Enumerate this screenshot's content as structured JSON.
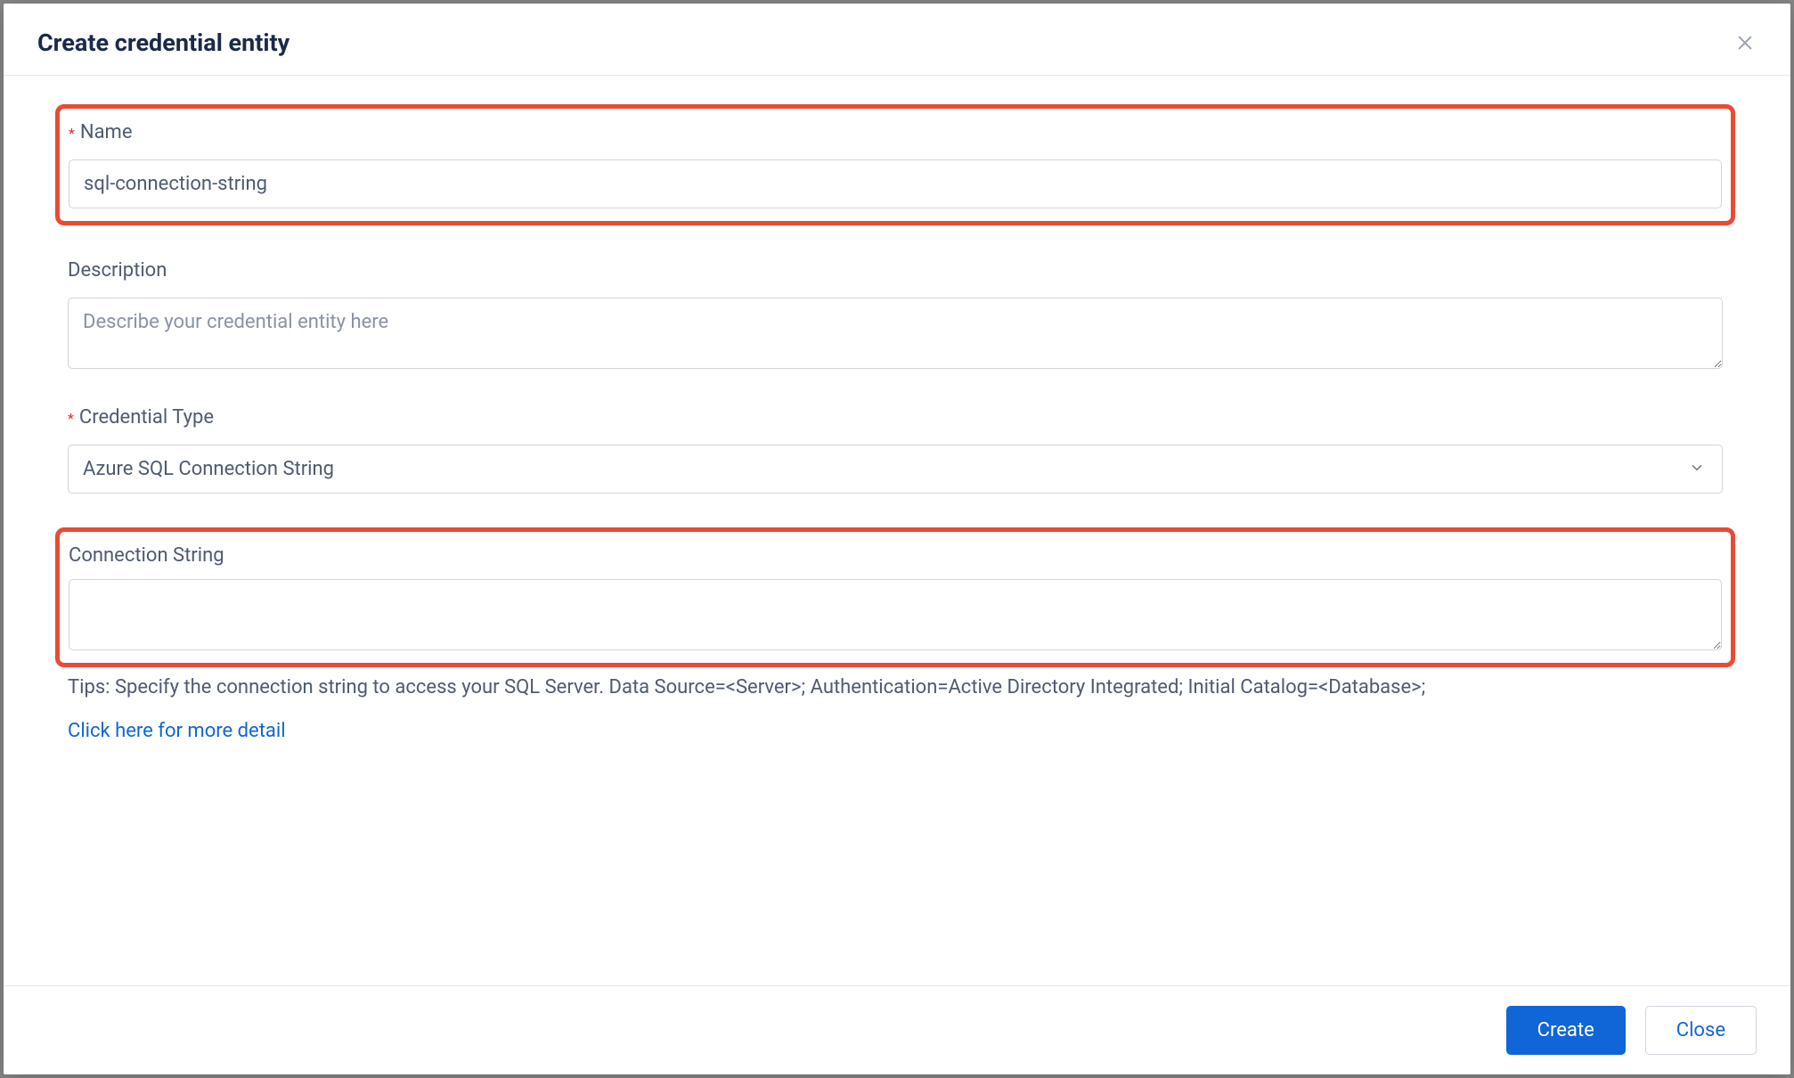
{
  "modal": {
    "title": "Create credential entity",
    "name": {
      "label": "Name",
      "value": "sql-connection-string",
      "required": true
    },
    "description": {
      "label": "Description",
      "placeholder": "Describe your credential entity here",
      "value": ""
    },
    "credentialType": {
      "label": "Credential Type",
      "selected": "Azure SQL Connection String",
      "required": true
    },
    "connectionString": {
      "label": "Connection String",
      "value": "",
      "tips": "Tips: Specify the connection string to access your SQL Server. Data Source=<Server>; Authentication=Active Directory Integrated; Initial Catalog=<Database>;",
      "moreDetailLink": "Click here for more detail"
    },
    "footer": {
      "create": "Create",
      "close": "Close"
    }
  }
}
